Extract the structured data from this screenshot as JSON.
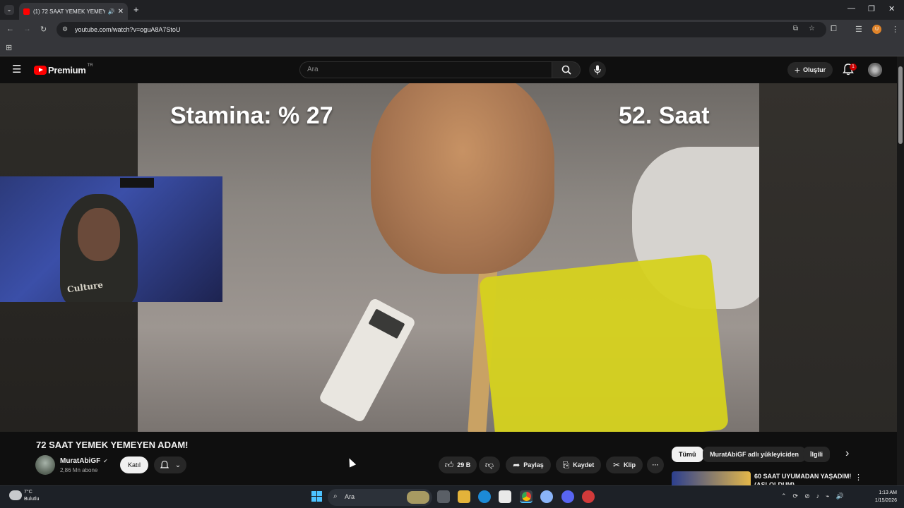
{
  "browser": {
    "tab_title": "(1) 72 SAAT YEMEK YEMEYEN",
    "tab_close": "✕",
    "new_tab": "+",
    "url": "youtube.com/watch?v=oguA8A7StoU",
    "window_controls": [
      "—",
      "❐",
      "✕"
    ]
  },
  "youtube": {
    "logo_text": "Premium",
    "logo_region": "TR",
    "search_placeholder": "Ara",
    "create_label": "Oluştur",
    "notification_count": "1"
  },
  "video": {
    "overlay_left": "Stamina: % 27",
    "overlay_right": "52. Saat",
    "webcam_shirt": "Culture",
    "title": "72 SAAT YEMEK YEMEYEN ADAM!",
    "channel": "MuratAbiGF",
    "subscribers": "2,86 Mn abone",
    "join_label": "Katıl",
    "likes": "29 B",
    "share_label": "Paylaş",
    "save_label": "Kaydet",
    "clip_label": "Klip",
    "more_label": "···"
  },
  "sidebar": {
    "chips": [
      "Tümü",
      "MuratAbiGF adlı yükleyiciden",
      "İlgili"
    ],
    "next_label": "›",
    "rec_title": "60 SAAT UYUMADAN YAŞADIM! (ASLOLDUM)"
  },
  "taskbar": {
    "temperature": "7°C",
    "condition": "Bulutlu",
    "search_label": "Ara",
    "time": "1:13 AM",
    "date": "1/15/2026"
  },
  "colors": {
    "accent_red": "#ff0000",
    "windows_blue": "#4cc2ff"
  }
}
